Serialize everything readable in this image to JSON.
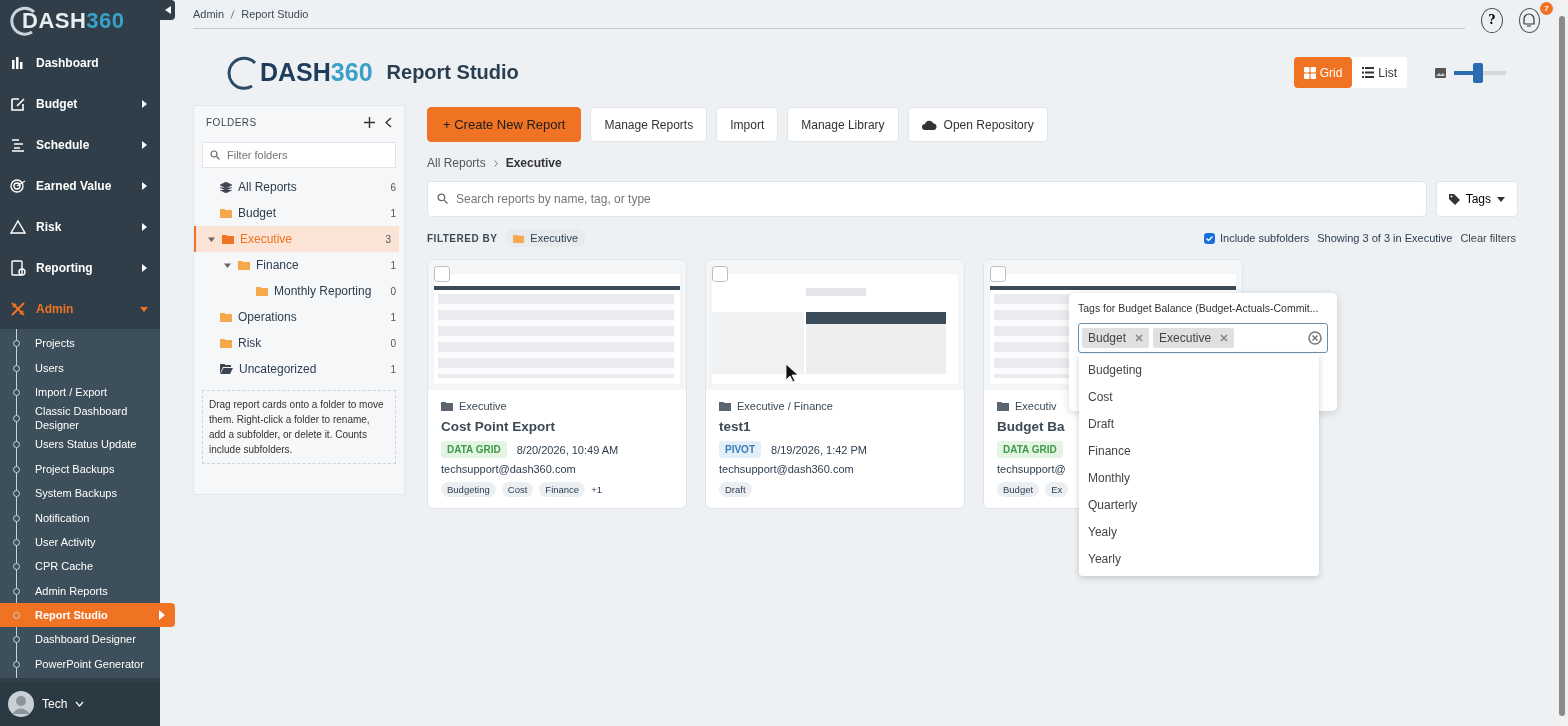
{
  "sidebar": {
    "logo_brand": "DASH",
    "logo_number": "360",
    "items": [
      {
        "label": "Dashboard",
        "has_submenu": false,
        "expanded": false
      },
      {
        "label": "Budget",
        "has_submenu": true,
        "expanded": false
      },
      {
        "label": "Schedule",
        "has_submenu": true,
        "expanded": false
      },
      {
        "label": "Earned Value",
        "has_submenu": true,
        "expanded": false
      },
      {
        "label": "Risk",
        "has_submenu": true,
        "expanded": false
      },
      {
        "label": "Reporting",
        "has_submenu": true,
        "expanded": false
      },
      {
        "label": "Admin",
        "has_submenu": true,
        "expanded": true
      }
    ],
    "subitems": [
      {
        "label": "Projects",
        "selected": false
      },
      {
        "label": "Users",
        "selected": false
      },
      {
        "label": "Import / Export",
        "selected": false
      },
      {
        "label": "Classic Dashboard Designer",
        "selected": false
      },
      {
        "label": "Users Status Update",
        "selected": false
      },
      {
        "label": "Project Backups",
        "selected": false
      },
      {
        "label": "System Backups",
        "selected": false
      },
      {
        "label": "Notification",
        "selected": false
      },
      {
        "label": "User Activity",
        "selected": false
      },
      {
        "label": "CPR Cache",
        "selected": false
      },
      {
        "label": "Admin Reports",
        "selected": false
      },
      {
        "label": "Report Studio",
        "selected": true
      },
      {
        "label": "Dashboard Designer",
        "selected": false
      },
      {
        "label": "PowerPoint Generator",
        "selected": false
      }
    ],
    "user": "Tech"
  },
  "breadcrumb": [
    "Admin",
    "Report Studio"
  ],
  "help_label": "?",
  "notification_count": "7",
  "header": {
    "logo_brand": "DASH",
    "logo_number": "360",
    "title": "Report Studio"
  },
  "view_toggle": [
    {
      "label": "Grid",
      "selected": true
    },
    {
      "label": "List",
      "selected": false
    }
  ],
  "thumb_size": {
    "level": 0.47
  },
  "folders": {
    "title": "FOLDERS",
    "filter_placeholder": "Filter folders",
    "items": [
      {
        "label": "All Reports",
        "count": "6",
        "kind": "all",
        "selected": false
      },
      {
        "label": "Budget",
        "count": "1",
        "kind": "folder",
        "selected": false
      },
      {
        "label": "Executive",
        "count": "3",
        "kind": "folder",
        "selected": true,
        "expanded": true,
        "children": [
          {
            "label": "Finance",
            "count": "1",
            "kind": "folder",
            "selected": false,
            "expanded": true,
            "children": [
              {
                "label": "Monthly Reporting",
                "count": "0",
                "kind": "folder",
                "selected": false
              }
            ]
          }
        ]
      },
      {
        "label": "Operations",
        "count": "1",
        "kind": "folder",
        "selected": false
      },
      {
        "label": "Risk",
        "count": "0",
        "kind": "folder",
        "selected": false
      },
      {
        "label": "Uncategorized",
        "count": "1",
        "kind": "uncategorized",
        "selected": false
      }
    ],
    "hint": "Drag report cards onto a folder to move them. Right-click a folder to rename, add a subfolder, or delete it. Counts include subfolders."
  },
  "actions": [
    {
      "label": "+ Create New Report",
      "kind": "primary"
    },
    {
      "label": "Manage Reports",
      "kind": "plain"
    },
    {
      "label": "Import",
      "kind": "plain"
    },
    {
      "label": "Manage Library",
      "kind": "plain"
    },
    {
      "label": "Open Repository",
      "kind": "cloud"
    }
  ],
  "path": [
    "All Reports",
    "Executive"
  ],
  "search": {
    "placeholder": "Search reports by name, tag, or type"
  },
  "tags_button": "Tags",
  "filter": {
    "label": "FILTERED BY",
    "chip": "Executive"
  },
  "include_subfolders": {
    "label": "Include subfolders",
    "checked": true
  },
  "showing": "Showing 3 of 3 in Executive",
  "clear_filters": "Clear filters",
  "cards": [
    {
      "folder": "Executive",
      "title": "Cost Point Export",
      "type": "DATA GRID",
      "kind": "grid",
      "date": "8/20/2026, 10:49 AM",
      "owner": "techsupport@dash360.com",
      "tags": [
        "Budgeting",
        "Cost",
        "Finance"
      ],
      "more": "+1",
      "selected": false
    },
    {
      "folder": "Executive / Finance",
      "title": "test1",
      "type": "PIVOT",
      "kind": "pivot",
      "date": "8/19/2026, 1:42 PM",
      "owner": "techsupport@dash360.com",
      "tags": [
        "Draft"
      ],
      "selected": false
    },
    {
      "folder": "Executiv",
      "title": "Budget Ba",
      "type": "DATA GRID",
      "kind": "grid",
      "owner": "techsupport@",
      "tags": [
        "Budget",
        "Ex"
      ],
      "selected": false
    }
  ],
  "tag_popover": {
    "title": "Tags for Budget Balance (Budget-Actuals-Commit...",
    "chips": [
      "Budget",
      "Executive"
    ],
    "options": [
      "Budgeting",
      "Cost",
      "Draft",
      "Finance",
      "Monthly",
      "Quarterly",
      "Yealy",
      "Yearly"
    ]
  }
}
